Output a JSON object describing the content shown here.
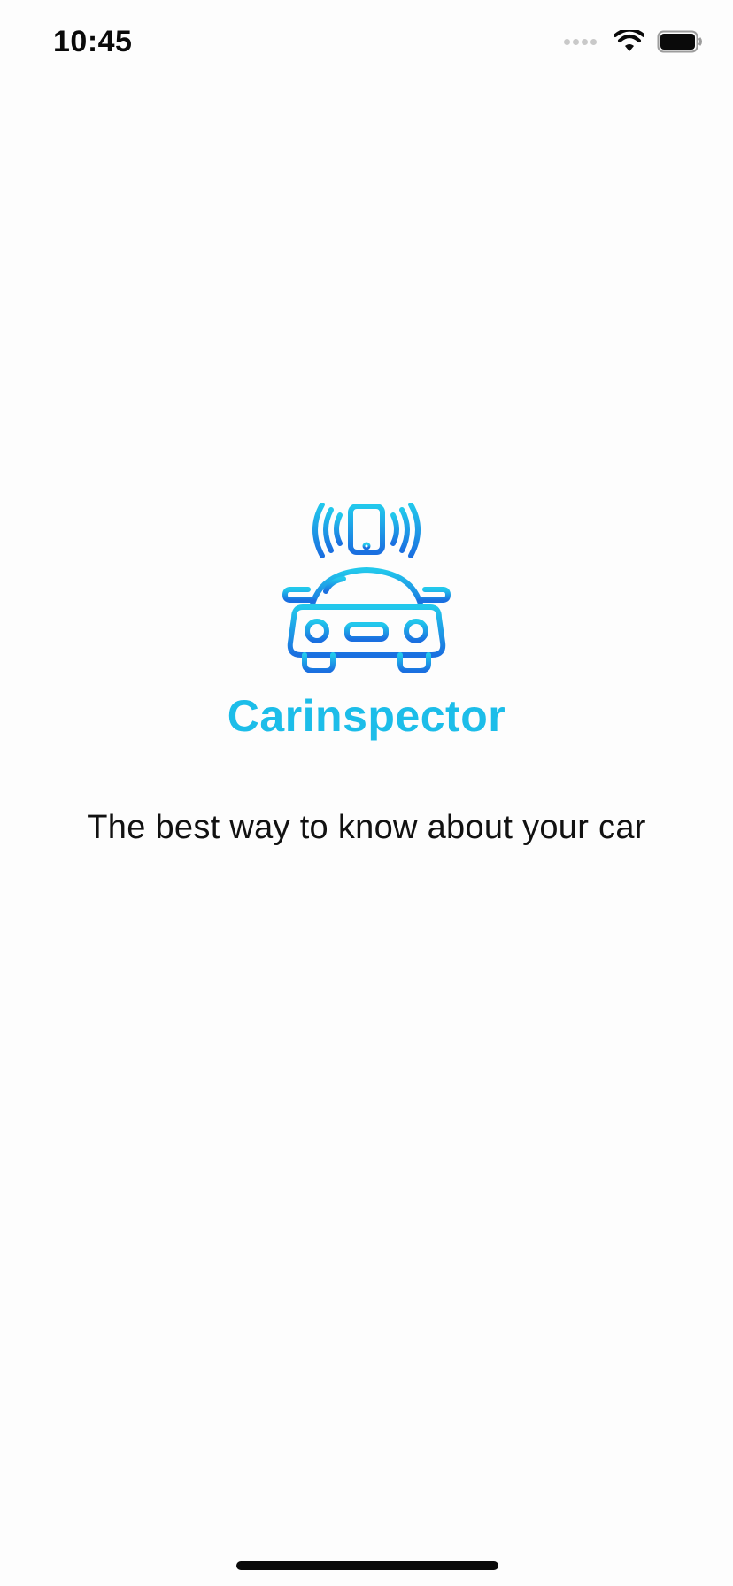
{
  "status_bar": {
    "time": "10:45",
    "icons": [
      "signal-dots-icon",
      "wifi-icon",
      "battery-icon"
    ]
  },
  "splash": {
    "logo_icon": "car-phone-signal-icon",
    "app_name": "Carinspector",
    "tagline": "The best way to know about your car"
  },
  "colors": {
    "background": "#fdfdfd",
    "brand_light": "#22c8ec",
    "brand_dark": "#1a6fe0",
    "text": "#111111"
  }
}
